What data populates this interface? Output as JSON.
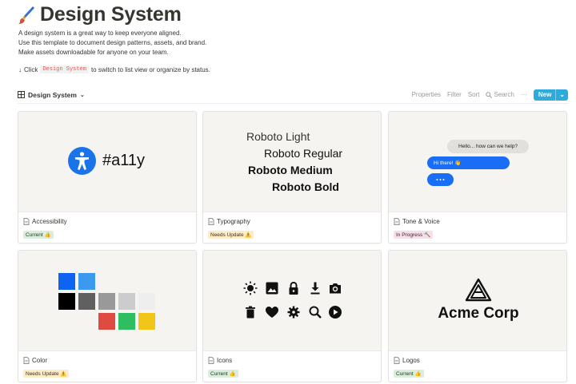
{
  "page": {
    "title": "Design System",
    "description": [
      "A design system is a great way to keep everyone aligned.",
      "Use this template to document design patterns, assets, and brand.",
      "Make assets downloadable for anyone on your team."
    ],
    "hint": {
      "arrow": "↓",
      "before": "Click",
      "code": "Design System",
      "after": "to switch to list view or organize by status."
    }
  },
  "database": {
    "title": "Design System",
    "actions": {
      "properties": "Properties",
      "filter": "Filter",
      "sort": "Sort",
      "search": "Search",
      "more": "···",
      "new": "New"
    }
  },
  "cards": [
    {
      "name": "Accessibility",
      "status": "Current 👍",
      "cover_text": "#a11y"
    },
    {
      "name": "Typography",
      "status": "Needs Update ⚠️",
      "fonts": [
        "Roboto Light",
        "Roboto Regular",
        "Roboto Medium",
        "Roboto Bold"
      ]
    },
    {
      "name": "Tone & Voice",
      "status": "In Progress 🔨",
      "chat": [
        "Hello... how can we help?",
        "Hi there! 👋",
        "• • •"
      ]
    },
    {
      "name": "Color",
      "status": "Needs Update ⚠️"
    },
    {
      "name": "Icons",
      "status": "Current 👍"
    },
    {
      "name": "Logos",
      "status": "Current 👍",
      "logo_text": "Acme Corp"
    }
  ],
  "colors": {
    "accent": "#2eaadc",
    "code_red": "#eb5757",
    "swatches": [
      "#0d64f0",
      "#3b9af0",
      "#000000",
      "#606060",
      "#999999",
      "#cccccc",
      "#eeeeee",
      "#e04b3f",
      "#2ebd5f",
      "#f2c618"
    ]
  },
  "icons": [
    "brush-emoji-icon",
    "table-view-icon",
    "search-icon",
    "document-icon",
    "sun-icon",
    "image-icon",
    "lock-icon",
    "download-icon",
    "camera-icon",
    "trash-icon",
    "heart-icon",
    "settings-icon",
    "magnifier-icon",
    "play-icon",
    "acme-logo-icon"
  ]
}
